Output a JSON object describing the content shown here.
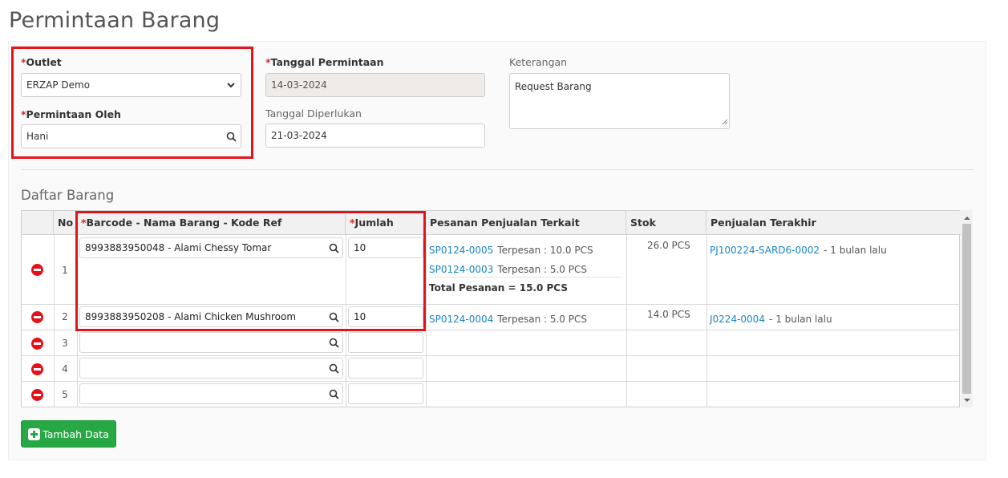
{
  "page": {
    "title": "Permintaan Barang"
  },
  "form": {
    "outlet": {
      "label": "Outlet",
      "required_mark": "*",
      "value": "ERZAP Demo"
    },
    "requested_by": {
      "label": "Permintaan Oleh",
      "required_mark": "*",
      "value": "Hani"
    },
    "request_date": {
      "label": "Tanggal Permintaan",
      "required_mark": "*",
      "value": "14-03-2024"
    },
    "needed_date": {
      "label": "Tanggal Diperlukan",
      "value": "21-03-2024"
    },
    "notes": {
      "label": "Keterangan",
      "value": "Request Barang"
    }
  },
  "section": {
    "title": "Daftar Barang"
  },
  "table": {
    "headers": {
      "no": "No",
      "item_required": "*",
      "item": "Barcode - Nama Barang - Kode Ref",
      "qty_required": "*",
      "qty": "Jumlah",
      "orders": "Pesanan Penjualan Terkait",
      "stock": "Stok",
      "last_sale": "Penjualan Terakhir"
    },
    "rows": [
      {
        "no": "1",
        "item": "8993883950048 - Alami Chessy Tomar",
        "qty": "10",
        "orders": [
          {
            "code": "SP0124-0005",
            "text": "Terpesan : 10.0 PCS"
          },
          {
            "code": "SP0124-0003",
            "text": "Terpesan : 5.0 PCS"
          }
        ],
        "total": "Total Pesanan  =  15.0 PCS",
        "stock": "26.0 PCS",
        "last_sale_code": "PJ100224-SARD6-0002",
        "last_sale_text": "- 1 bulan lalu"
      },
      {
        "no": "2",
        "item": "8993883950208 - Alami Chicken Mushroom",
        "qty": "10",
        "orders": [
          {
            "code": "SP0124-0004",
            "text": "Terpesan : 5.0 PCS"
          }
        ],
        "stock": "14.0 PCS",
        "last_sale_code": "J0224-0004",
        "last_sale_text": "- 1 bulan lalu"
      },
      {
        "no": "3",
        "item": "",
        "qty": ""
      },
      {
        "no": "4",
        "item": "",
        "qty": ""
      },
      {
        "no": "5",
        "item": "",
        "qty": ""
      }
    ]
  },
  "actions": {
    "add_label": "Tambah Data"
  },
  "icons": {
    "search": "search-icon",
    "delete": "remove-circle-icon",
    "dropdown": "chevron-down-icon",
    "add": "plus-square-icon"
  },
  "colors": {
    "required": "#d9261c",
    "link": "#1a85c8",
    "add_button": "#28a745",
    "delete": "#e3111a",
    "highlight": "#e0151b"
  }
}
